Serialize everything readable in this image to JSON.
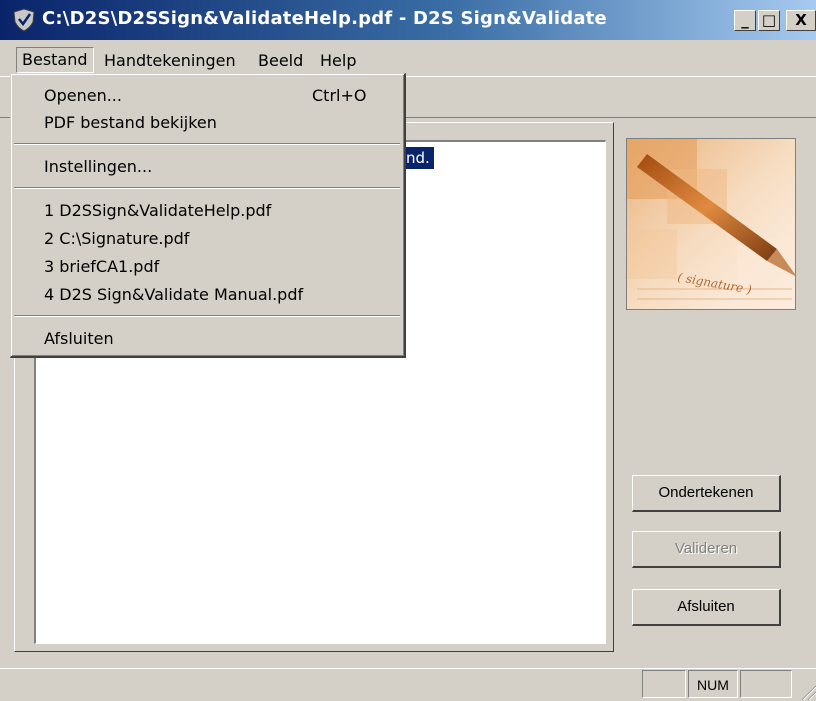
{
  "window": {
    "title": "C:\\D2S\\D2SSign&ValidateHelp.pdf - D2S Sign&Validate",
    "minimize": "_",
    "maximize": "□",
    "close": "X"
  },
  "menubar": {
    "items": [
      {
        "label": "Bestand"
      },
      {
        "label": "Handtekeningen"
      },
      {
        "label": "Beeld"
      },
      {
        "label": "Help"
      }
    ]
  },
  "file_menu": {
    "open": {
      "label": "Openen...",
      "shortcut": "Ctrl+O"
    },
    "view_pdf": {
      "label": "PDF bestand bekijken"
    },
    "settings": {
      "label": "Instellingen..."
    },
    "recent": [
      "1 D2SSign&ValidateHelp.pdf",
      "2 C:\\Signature.pdf",
      "3 briefCA1.pdf",
      "4 D2S Sign&Validate Manual.pdf"
    ],
    "exit": {
      "label": "Afsluiten"
    }
  },
  "document_list": {
    "selected_fragment": "nd."
  },
  "signature_image": {
    "icon": "fountain-pen-signature",
    "caption": "( signature )",
    "accent_color": "#e8a050"
  },
  "actions": {
    "sign": "Ondertekenen",
    "validate": "Valideren",
    "close": "Afsluiten"
  },
  "statusbar": {
    "num": "NUM"
  }
}
